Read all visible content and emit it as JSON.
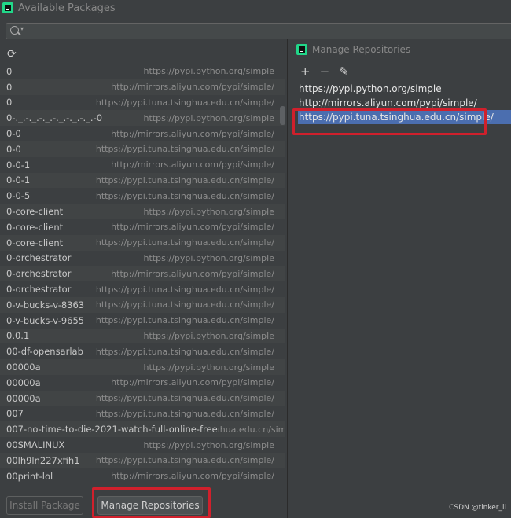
{
  "window": {
    "title": "Available Packages"
  },
  "search": {
    "placeholder": ""
  },
  "packages": [
    {
      "name": "0",
      "repo": "https://pypi.python.org/simple"
    },
    {
      "name": "0",
      "repo": "http://mirrors.aliyun.com/pypi/simple/"
    },
    {
      "name": "0",
      "repo": "https://pypi.tuna.tsinghua.edu.cn/simple/"
    },
    {
      "name": "0-._.-._.-._.-._.-._.-._.-0",
      "repo": "https://pypi.python.org/simple"
    },
    {
      "name": "0-0",
      "repo": "http://mirrors.aliyun.com/pypi/simple/"
    },
    {
      "name": "0-0",
      "repo": "https://pypi.tuna.tsinghua.edu.cn/simple/"
    },
    {
      "name": "0-0-1",
      "repo": "http://mirrors.aliyun.com/pypi/simple/"
    },
    {
      "name": "0-0-1",
      "repo": "https://pypi.tuna.tsinghua.edu.cn/simple/"
    },
    {
      "name": "0-0-5",
      "repo": "https://pypi.tuna.tsinghua.edu.cn/simple/"
    },
    {
      "name": "0-core-client",
      "repo": "https://pypi.python.org/simple"
    },
    {
      "name": "0-core-client",
      "repo": "http://mirrors.aliyun.com/pypi/simple/"
    },
    {
      "name": "0-core-client",
      "repo": "https://pypi.tuna.tsinghua.edu.cn/simple/"
    },
    {
      "name": "0-orchestrator",
      "repo": "https://pypi.python.org/simple"
    },
    {
      "name": "0-orchestrator",
      "repo": "http://mirrors.aliyun.com/pypi/simple/"
    },
    {
      "name": "0-orchestrator",
      "repo": "https://pypi.tuna.tsinghua.edu.cn/simple/"
    },
    {
      "name": "0-v-bucks-v-8363",
      "repo": "https://pypi.tuna.tsinghua.edu.cn/simple/"
    },
    {
      "name": "0-v-bucks-v-9655",
      "repo": "https://pypi.tuna.tsinghua.edu.cn/simple/"
    },
    {
      "name": "0.0.1",
      "repo": "https://pypi.python.org/simple"
    },
    {
      "name": "00-df-opensarlab",
      "repo": "https://pypi.tuna.tsinghua.edu.cn/simple/"
    },
    {
      "name": "00000a",
      "repo": "https://pypi.python.org/simple"
    },
    {
      "name": "00000a",
      "repo": "http://mirrors.aliyun.com/pypi/simple/"
    },
    {
      "name": "00000a",
      "repo": "https://pypi.tuna.tsinghua.edu.cn/simple/"
    },
    {
      "name": "007",
      "repo": "https://pypi.tuna.tsinghua.edu.cn/simple/"
    },
    {
      "name": "007-no-time-to-die-2021-watch-full-online-free",
      "repo": "ıhua.edu.cn/simple/"
    },
    {
      "name": "00SMALINUX",
      "repo": "https://pypi.python.org/simple"
    },
    {
      "name": "00lh9ln227xfih1",
      "repo": "https://pypi.tuna.tsinghua.edu.cn/simple/"
    },
    {
      "name": "00print-lol",
      "repo": "http://mirrors.aliyun.com/pypi/simple/"
    }
  ],
  "buttons": {
    "install": "Install Package",
    "manage": "Manage Repositories"
  },
  "dialog": {
    "title": "Manage Repositories",
    "toolbar": {
      "add": "+",
      "remove": "−",
      "edit": "✎"
    },
    "repositories": [
      "https://pypi.python.org/simple",
      "http://mirrors.aliyun.com/pypi/simple/",
      "https://pypi.tuna.tsinghua.edu.cn/simple/"
    ],
    "selected_index": 2
  },
  "watermark": "CSDN @tinker_li",
  "colors": {
    "selection": "#4b6eaf",
    "highlight": "#d0202c",
    "background": "#3c3f41"
  },
  "icons": {
    "app": "pycharm-icon",
    "search": "search-icon",
    "refresh": "refresh-icon"
  }
}
